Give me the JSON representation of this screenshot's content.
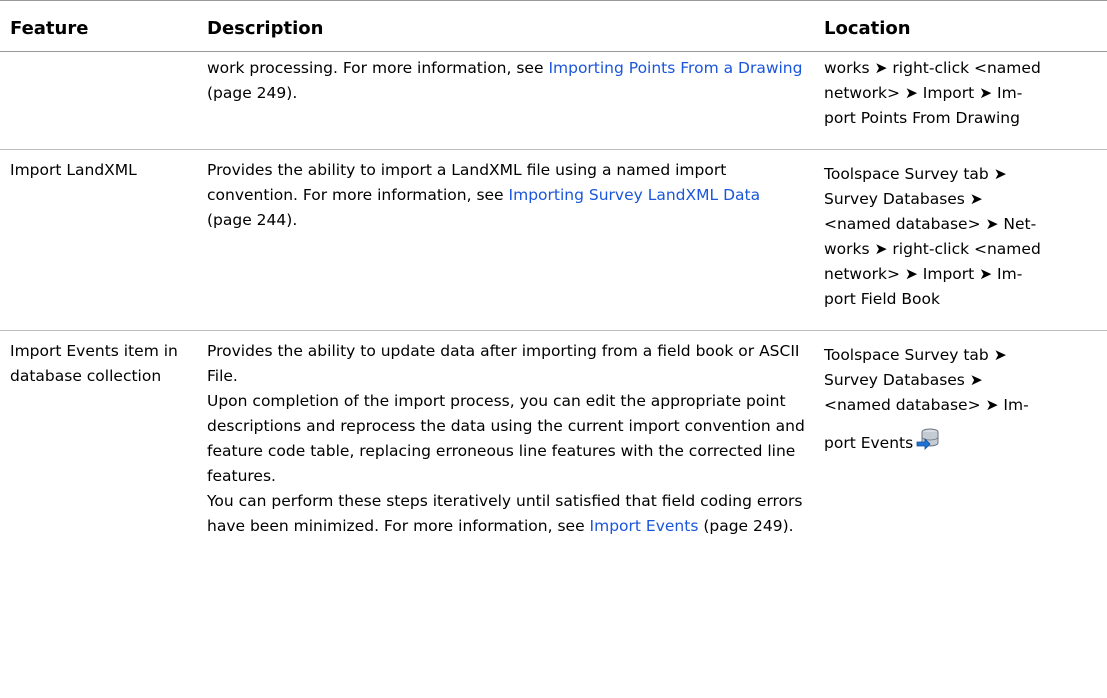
{
  "header": {
    "feature": "Feature",
    "description": "Description",
    "location": "Location"
  },
  "rows": [
    {
      "feature": "",
      "description": {
        "t1": "work processing. For more information, see ",
        "link1": "Importing Points From a Drawing",
        "t2": " (page 249)."
      },
      "location": {
        "l1": "works ➤ right-click <named",
        "l2": "network> ➤ Import ➤ Im-",
        "l3": "port Points From Drawing"
      }
    },
    {
      "feature": "Import LandXML",
      "description": {
        "t1": "Provides the ability to import a LandXML file using a named import convention. For more information, see ",
        "link1": "Importing Survey LandXML Data",
        "t2": " (page 244)."
      },
      "location": {
        "l1": "Toolspace Survey tab ➤",
        "l2": "Survey Databases ➤",
        "l3": "<named database> ➤ Net-",
        "l4": "works ➤ right-click <named",
        "l5": "network> ➤ Import ➤ Im-",
        "l6": "port Field Book"
      }
    },
    {
      "feature": "Import Events item in database collection",
      "description": {
        "p1": "Provides the ability to update data after importing from a field book or ASCII File.",
        "p2": "Upon completion of the import process, you can edit the appropriate point descriptions and reprocess the data using the current import convention and feature code table, replacing erroneous line features with the corrected line features.",
        "p3": "You can perform these steps iteratively until satisfied that field coding errors have been minimized. For more information, see ",
        "link1": "Import Events",
        "t2": " (page 249)."
      },
      "location": {
        "l1": "Toolspace Survey tab ➤",
        "l2": "Survey Databases ➤",
        "l3": "<named database> ➤ Im-",
        "l4": "port Events"
      },
      "icon": "import-events-database-icon"
    }
  ],
  "colors": {
    "link": "#1a56db",
    "rule": "#999999"
  }
}
